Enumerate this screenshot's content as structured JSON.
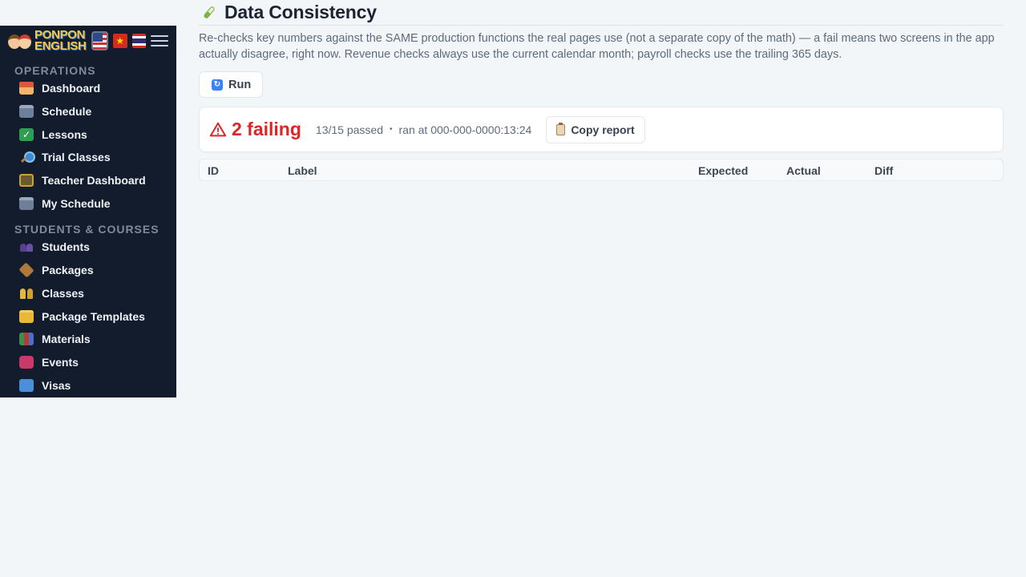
{
  "brand": {
    "line1": "PONPON",
    "line2": "ENGLISH"
  },
  "languages": [
    {
      "code": "en",
      "icon": "us-flag-icon"
    },
    {
      "code": "vi",
      "icon": "vietnam-flag-icon"
    },
    {
      "code": "th",
      "icon": "thailand-flag-icon"
    }
  ],
  "sidebar": {
    "sections": [
      {
        "title": "OPERATIONS",
        "items": [
          {
            "label": "Dashboard",
            "icon": "house-icon"
          },
          {
            "label": "Schedule",
            "icon": "calendar-icon"
          },
          {
            "label": "Lessons",
            "icon": "checkmark-icon"
          },
          {
            "label": "Trial Classes",
            "icon": "magnifier-icon"
          },
          {
            "label": "Teacher Dashboard",
            "icon": "teacher-board-icon"
          },
          {
            "label": "My Schedule",
            "icon": "calendar-icon"
          }
        ]
      },
      {
        "title": "STUDENTS & COURSES",
        "items": [
          {
            "label": "Students",
            "icon": "people-icon"
          },
          {
            "label": "Packages",
            "icon": "package-icon"
          },
          {
            "label": "Classes",
            "icon": "group-icon"
          },
          {
            "label": "Package Templates",
            "icon": "folder-icon"
          },
          {
            "label": "Materials",
            "icon": "books-icon"
          },
          {
            "label": "Events",
            "icon": "ticket-icon"
          },
          {
            "label": "Visas",
            "icon": "passport-icon"
          }
        ]
      }
    ]
  },
  "page": {
    "title": "Data Consistency",
    "title_icon": "test-tube-icon",
    "description": "Re-checks key numbers against the SAME production functions the real pages use (not a separate copy of the math) — a fail means two screens in the app actually disagree, right now. Revenue checks always use the current calendar month; payroll checks use the trailing 365 days.",
    "run_label": "Run"
  },
  "summary": {
    "failing_label": "2 failing",
    "passed_label": "13/15 passed",
    "separator": "•",
    "ran_at_label": "ran at 000-000-0000:13:24",
    "copy_label": "Copy report"
  },
  "table": {
    "columns": [
      "ID",
      "Label",
      "Expected",
      "Actual",
      "Diff"
    ]
  },
  "colors": {
    "sidebar_bg": "#131c2c",
    "page_bg": "#f3f6f9",
    "fail_red": "#dc2626",
    "accent_blue": "#3b82f6"
  }
}
